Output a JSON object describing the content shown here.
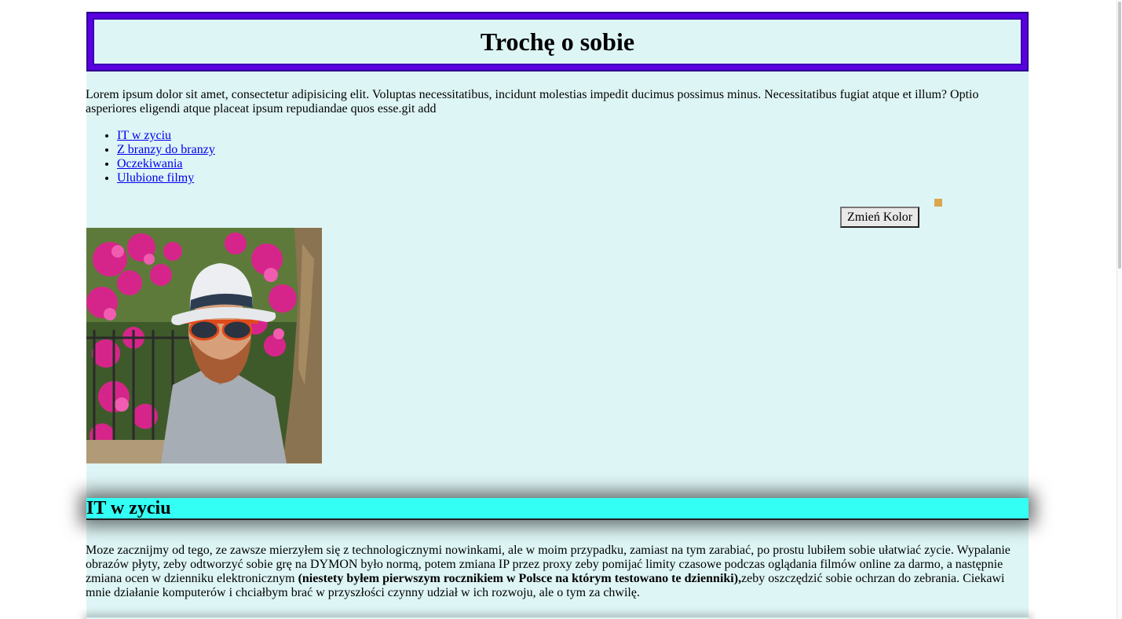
{
  "header": {
    "title": "Trochę o sobie"
  },
  "intro": {
    "text": "Lorem ipsum dolor sit amet, consectetur adipisicing elit. Voluptas necessitatibus, incidunt molestias impedit ducimus possimus minus. Necessitatibus fugiat atque et illum? Optio asperiores eligendi atque placeat ipsum repudiandae quos esse.git add"
  },
  "nav": {
    "items": [
      {
        "label": "IT w zyciu"
      },
      {
        "label": "Z branzy do branzy"
      },
      {
        "label": "Oczekiwania"
      },
      {
        "label": "Ulubione filmy"
      }
    ]
  },
  "controls": {
    "color_button_label": "Zmień Kolor",
    "color_square": "#d9a84e"
  },
  "colors": {
    "page_bg": "#def5f5",
    "header_border": "#5a00e0",
    "section_heading_bg": "#33fff5",
    "link": "#0000ee"
  },
  "section": {
    "heading": "IT w zyciu",
    "text_before_bold": "Moze zacznijmy od tego, ze zawsze mierzyłem się z technologicznymi nowinkami, ale w moim przypadku, zamiast na tym zarabiać, po prostu lubiłem sobie ułatwiać zycie. Wypalanie obrazów płyty, zeby odtworzyć sobie grę na DYMON było normą, potem zmiana IP przez proxy zeby pomijać limity czasowe podczas oglądania filmów online za darmo, a następnie zmiana ocen w dzienniku elektronicznym ",
    "bold_text": "(niestety byłem pierwszym rocznikiem w Polsce na którym testowano te dzienniki),",
    "text_after_bold": "zeby oszczędzić sobie ochrzan do zebrania. Ciekawi mnie działanie komputerów i chciałbym brać w przyszłości czynny udział w ich rozwoju, ale o tym za chwilę."
  },
  "photo": {
    "icon": "profile-photo"
  }
}
